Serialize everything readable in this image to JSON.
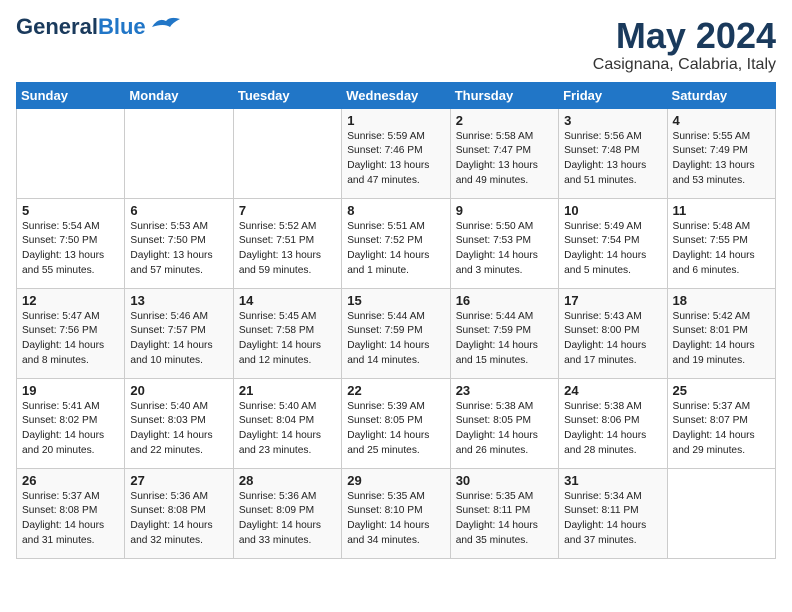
{
  "logo": {
    "line1": "General",
    "line2": "Blue"
  },
  "title": "May 2024",
  "location": "Casignana, Calabria, Italy",
  "days_of_week": [
    "Sunday",
    "Monday",
    "Tuesday",
    "Wednesday",
    "Thursday",
    "Friday",
    "Saturday"
  ],
  "weeks": [
    [
      {
        "day": "",
        "info": ""
      },
      {
        "day": "",
        "info": ""
      },
      {
        "day": "",
        "info": ""
      },
      {
        "day": "1",
        "info": "Sunrise: 5:59 AM\nSunset: 7:46 PM\nDaylight: 13 hours\nand 47 minutes."
      },
      {
        "day": "2",
        "info": "Sunrise: 5:58 AM\nSunset: 7:47 PM\nDaylight: 13 hours\nand 49 minutes."
      },
      {
        "day": "3",
        "info": "Sunrise: 5:56 AM\nSunset: 7:48 PM\nDaylight: 13 hours\nand 51 minutes."
      },
      {
        "day": "4",
        "info": "Sunrise: 5:55 AM\nSunset: 7:49 PM\nDaylight: 13 hours\nand 53 minutes."
      }
    ],
    [
      {
        "day": "5",
        "info": "Sunrise: 5:54 AM\nSunset: 7:50 PM\nDaylight: 13 hours\nand 55 minutes."
      },
      {
        "day": "6",
        "info": "Sunrise: 5:53 AM\nSunset: 7:50 PM\nDaylight: 13 hours\nand 57 minutes."
      },
      {
        "day": "7",
        "info": "Sunrise: 5:52 AM\nSunset: 7:51 PM\nDaylight: 13 hours\nand 59 minutes."
      },
      {
        "day": "8",
        "info": "Sunrise: 5:51 AM\nSunset: 7:52 PM\nDaylight: 14 hours\nand 1 minute."
      },
      {
        "day": "9",
        "info": "Sunrise: 5:50 AM\nSunset: 7:53 PM\nDaylight: 14 hours\nand 3 minutes."
      },
      {
        "day": "10",
        "info": "Sunrise: 5:49 AM\nSunset: 7:54 PM\nDaylight: 14 hours\nand 5 minutes."
      },
      {
        "day": "11",
        "info": "Sunrise: 5:48 AM\nSunset: 7:55 PM\nDaylight: 14 hours\nand 6 minutes."
      }
    ],
    [
      {
        "day": "12",
        "info": "Sunrise: 5:47 AM\nSunset: 7:56 PM\nDaylight: 14 hours\nand 8 minutes."
      },
      {
        "day": "13",
        "info": "Sunrise: 5:46 AM\nSunset: 7:57 PM\nDaylight: 14 hours\nand 10 minutes."
      },
      {
        "day": "14",
        "info": "Sunrise: 5:45 AM\nSunset: 7:58 PM\nDaylight: 14 hours\nand 12 minutes."
      },
      {
        "day": "15",
        "info": "Sunrise: 5:44 AM\nSunset: 7:59 PM\nDaylight: 14 hours\nand 14 minutes."
      },
      {
        "day": "16",
        "info": "Sunrise: 5:44 AM\nSunset: 7:59 PM\nDaylight: 14 hours\nand 15 minutes."
      },
      {
        "day": "17",
        "info": "Sunrise: 5:43 AM\nSunset: 8:00 PM\nDaylight: 14 hours\nand 17 minutes."
      },
      {
        "day": "18",
        "info": "Sunrise: 5:42 AM\nSunset: 8:01 PM\nDaylight: 14 hours\nand 19 minutes."
      }
    ],
    [
      {
        "day": "19",
        "info": "Sunrise: 5:41 AM\nSunset: 8:02 PM\nDaylight: 14 hours\nand 20 minutes."
      },
      {
        "day": "20",
        "info": "Sunrise: 5:40 AM\nSunset: 8:03 PM\nDaylight: 14 hours\nand 22 minutes."
      },
      {
        "day": "21",
        "info": "Sunrise: 5:40 AM\nSunset: 8:04 PM\nDaylight: 14 hours\nand 23 minutes."
      },
      {
        "day": "22",
        "info": "Sunrise: 5:39 AM\nSunset: 8:05 PM\nDaylight: 14 hours\nand 25 minutes."
      },
      {
        "day": "23",
        "info": "Sunrise: 5:38 AM\nSunset: 8:05 PM\nDaylight: 14 hours\nand 26 minutes."
      },
      {
        "day": "24",
        "info": "Sunrise: 5:38 AM\nSunset: 8:06 PM\nDaylight: 14 hours\nand 28 minutes."
      },
      {
        "day": "25",
        "info": "Sunrise: 5:37 AM\nSunset: 8:07 PM\nDaylight: 14 hours\nand 29 minutes."
      }
    ],
    [
      {
        "day": "26",
        "info": "Sunrise: 5:37 AM\nSunset: 8:08 PM\nDaylight: 14 hours\nand 31 minutes."
      },
      {
        "day": "27",
        "info": "Sunrise: 5:36 AM\nSunset: 8:08 PM\nDaylight: 14 hours\nand 32 minutes."
      },
      {
        "day": "28",
        "info": "Sunrise: 5:36 AM\nSunset: 8:09 PM\nDaylight: 14 hours\nand 33 minutes."
      },
      {
        "day": "29",
        "info": "Sunrise: 5:35 AM\nSunset: 8:10 PM\nDaylight: 14 hours\nand 34 minutes."
      },
      {
        "day": "30",
        "info": "Sunrise: 5:35 AM\nSunset: 8:11 PM\nDaylight: 14 hours\nand 35 minutes."
      },
      {
        "day": "31",
        "info": "Sunrise: 5:34 AM\nSunset: 8:11 PM\nDaylight: 14 hours\nand 37 minutes."
      },
      {
        "day": "",
        "info": ""
      }
    ]
  ]
}
